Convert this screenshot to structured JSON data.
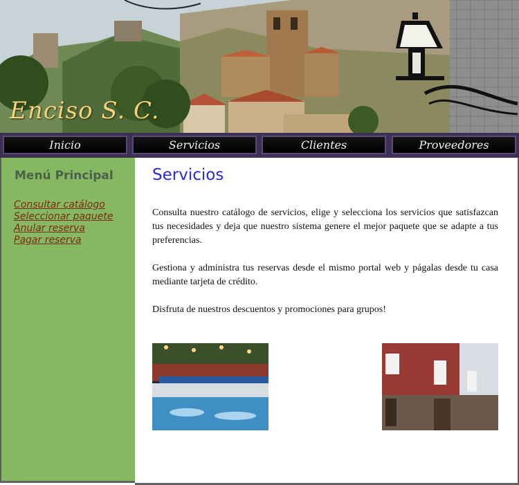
{
  "header": {
    "logo_text": "Enciso S. C."
  },
  "nav": {
    "items": [
      {
        "label": "Inicio"
      },
      {
        "label": "Servicios"
      },
      {
        "label": "Clientes"
      },
      {
        "label": "Proveedores"
      }
    ]
  },
  "sidebar": {
    "title": "Menú Principal",
    "links": [
      {
        "label": "Consultar catálogo"
      },
      {
        "label": "Seleccionar paquete"
      },
      {
        "label": "Anular reserva"
      },
      {
        "label": "Pagar reserva"
      }
    ]
  },
  "main": {
    "title": "Servicios",
    "paragraphs": [
      "Consulta nuestro catálogo de servicios, elige y selecciona los servicios que satisfazcan tus necesidades y deja que nuestro sistema genere el mejor paquete que se adapte a tus preferencias.",
      "Gestiona y administra tus reservas desde el mismo portal web y págalas desde tu casa mediante tarjeta de crédito.",
      "Disfruta de nuestros descuentos y promociones para grupos!"
    ]
  },
  "colors": {
    "sidebar_bg": "#86b862",
    "nav_bg": "#3e2f55",
    "title_blue": "#2a2ad8",
    "link_color": "#7a2a10"
  }
}
